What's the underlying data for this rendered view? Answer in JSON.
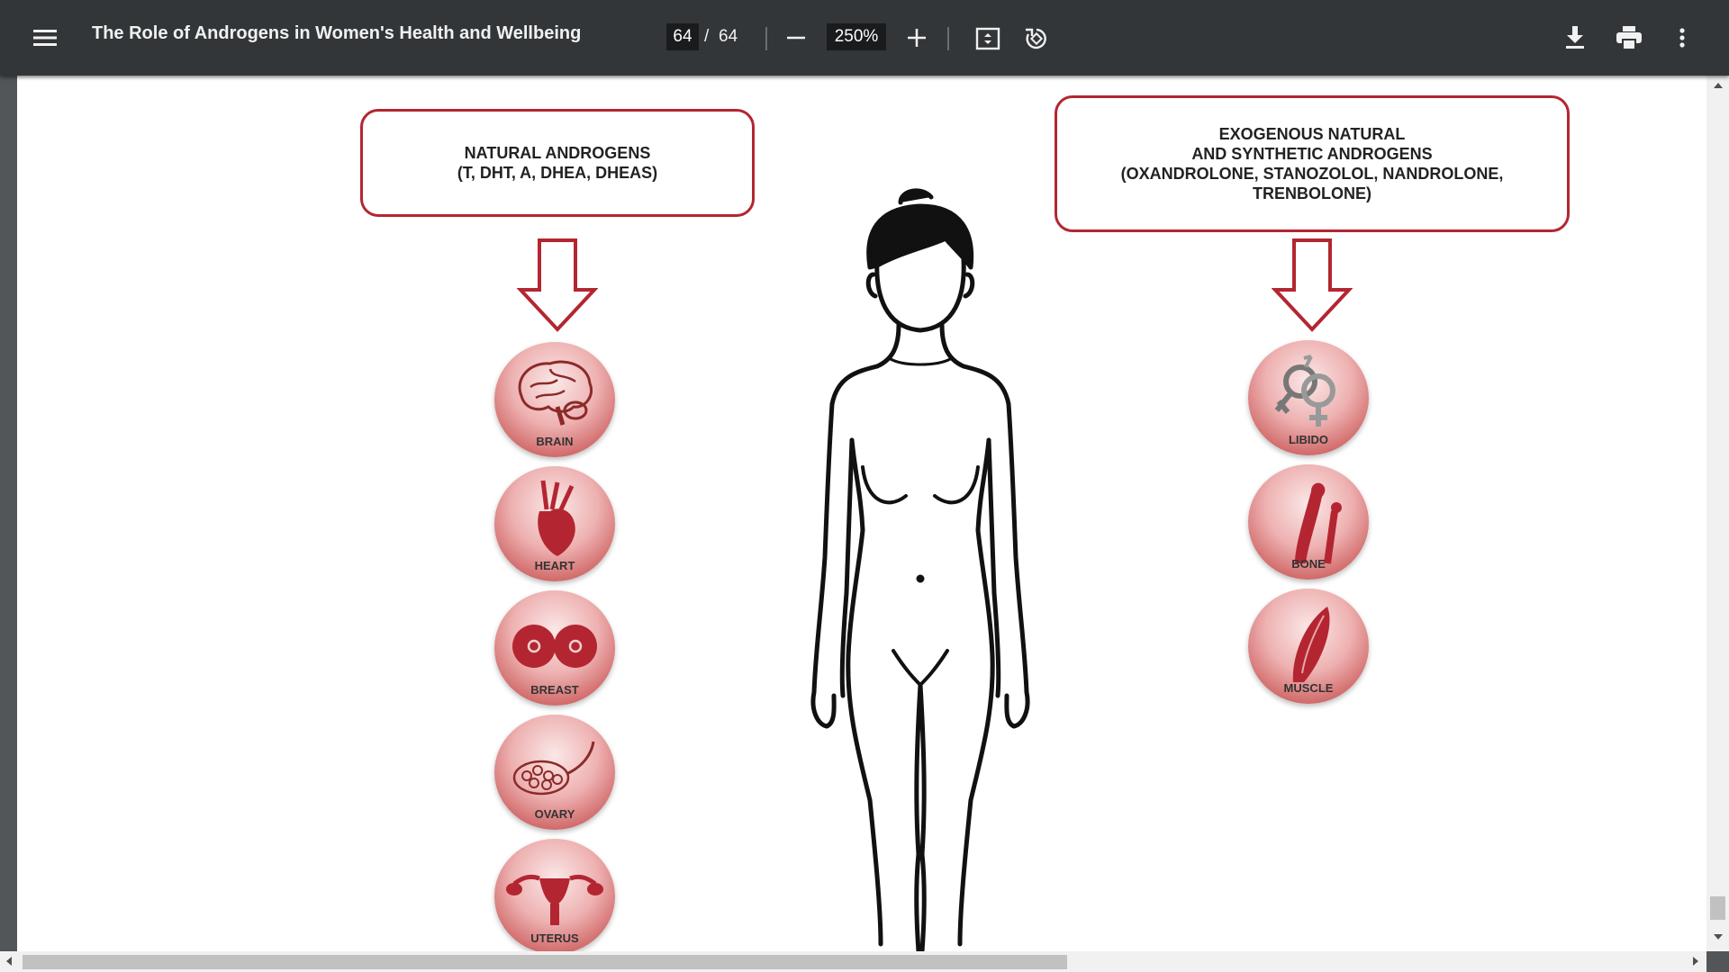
{
  "toolbar": {
    "title": "The Role of Androgens in Women's Health and Wellbeing",
    "page_current": "64",
    "page_separator": "/",
    "page_total": "64",
    "zoom": "250%",
    "icons": [
      "menu-icon",
      "zoom-out-icon",
      "zoom-in-icon",
      "fit-page-icon",
      "rotate-icon",
      "download-icon",
      "print-icon",
      "more-vert-icon"
    ]
  },
  "diagram": {
    "left_box_line1": "NATURAL ANDROGENS",
    "left_box_line2": "(T, DHT, A, DHEA, DHEAS)",
    "right_box_line1": "EXOGENOUS NATURAL",
    "right_box_line2": "AND SYNTHETIC ANDROGENS",
    "right_box_line3": "(OXANDROLONE, STANOZOLOL, NANDROLONE,",
    "right_box_line4": "TRENBOLONE)",
    "left_organs": [
      "BRAIN",
      "HEART",
      "BREAST",
      "OVARY",
      "UTERUS"
    ],
    "right_organs": [
      "LIBIDO",
      "BONE",
      "MUSCLE"
    ]
  },
  "colors": {
    "toolbar_bg": "#323639",
    "accent_red": "#b32631",
    "page_bg": "#ffffff"
  }
}
